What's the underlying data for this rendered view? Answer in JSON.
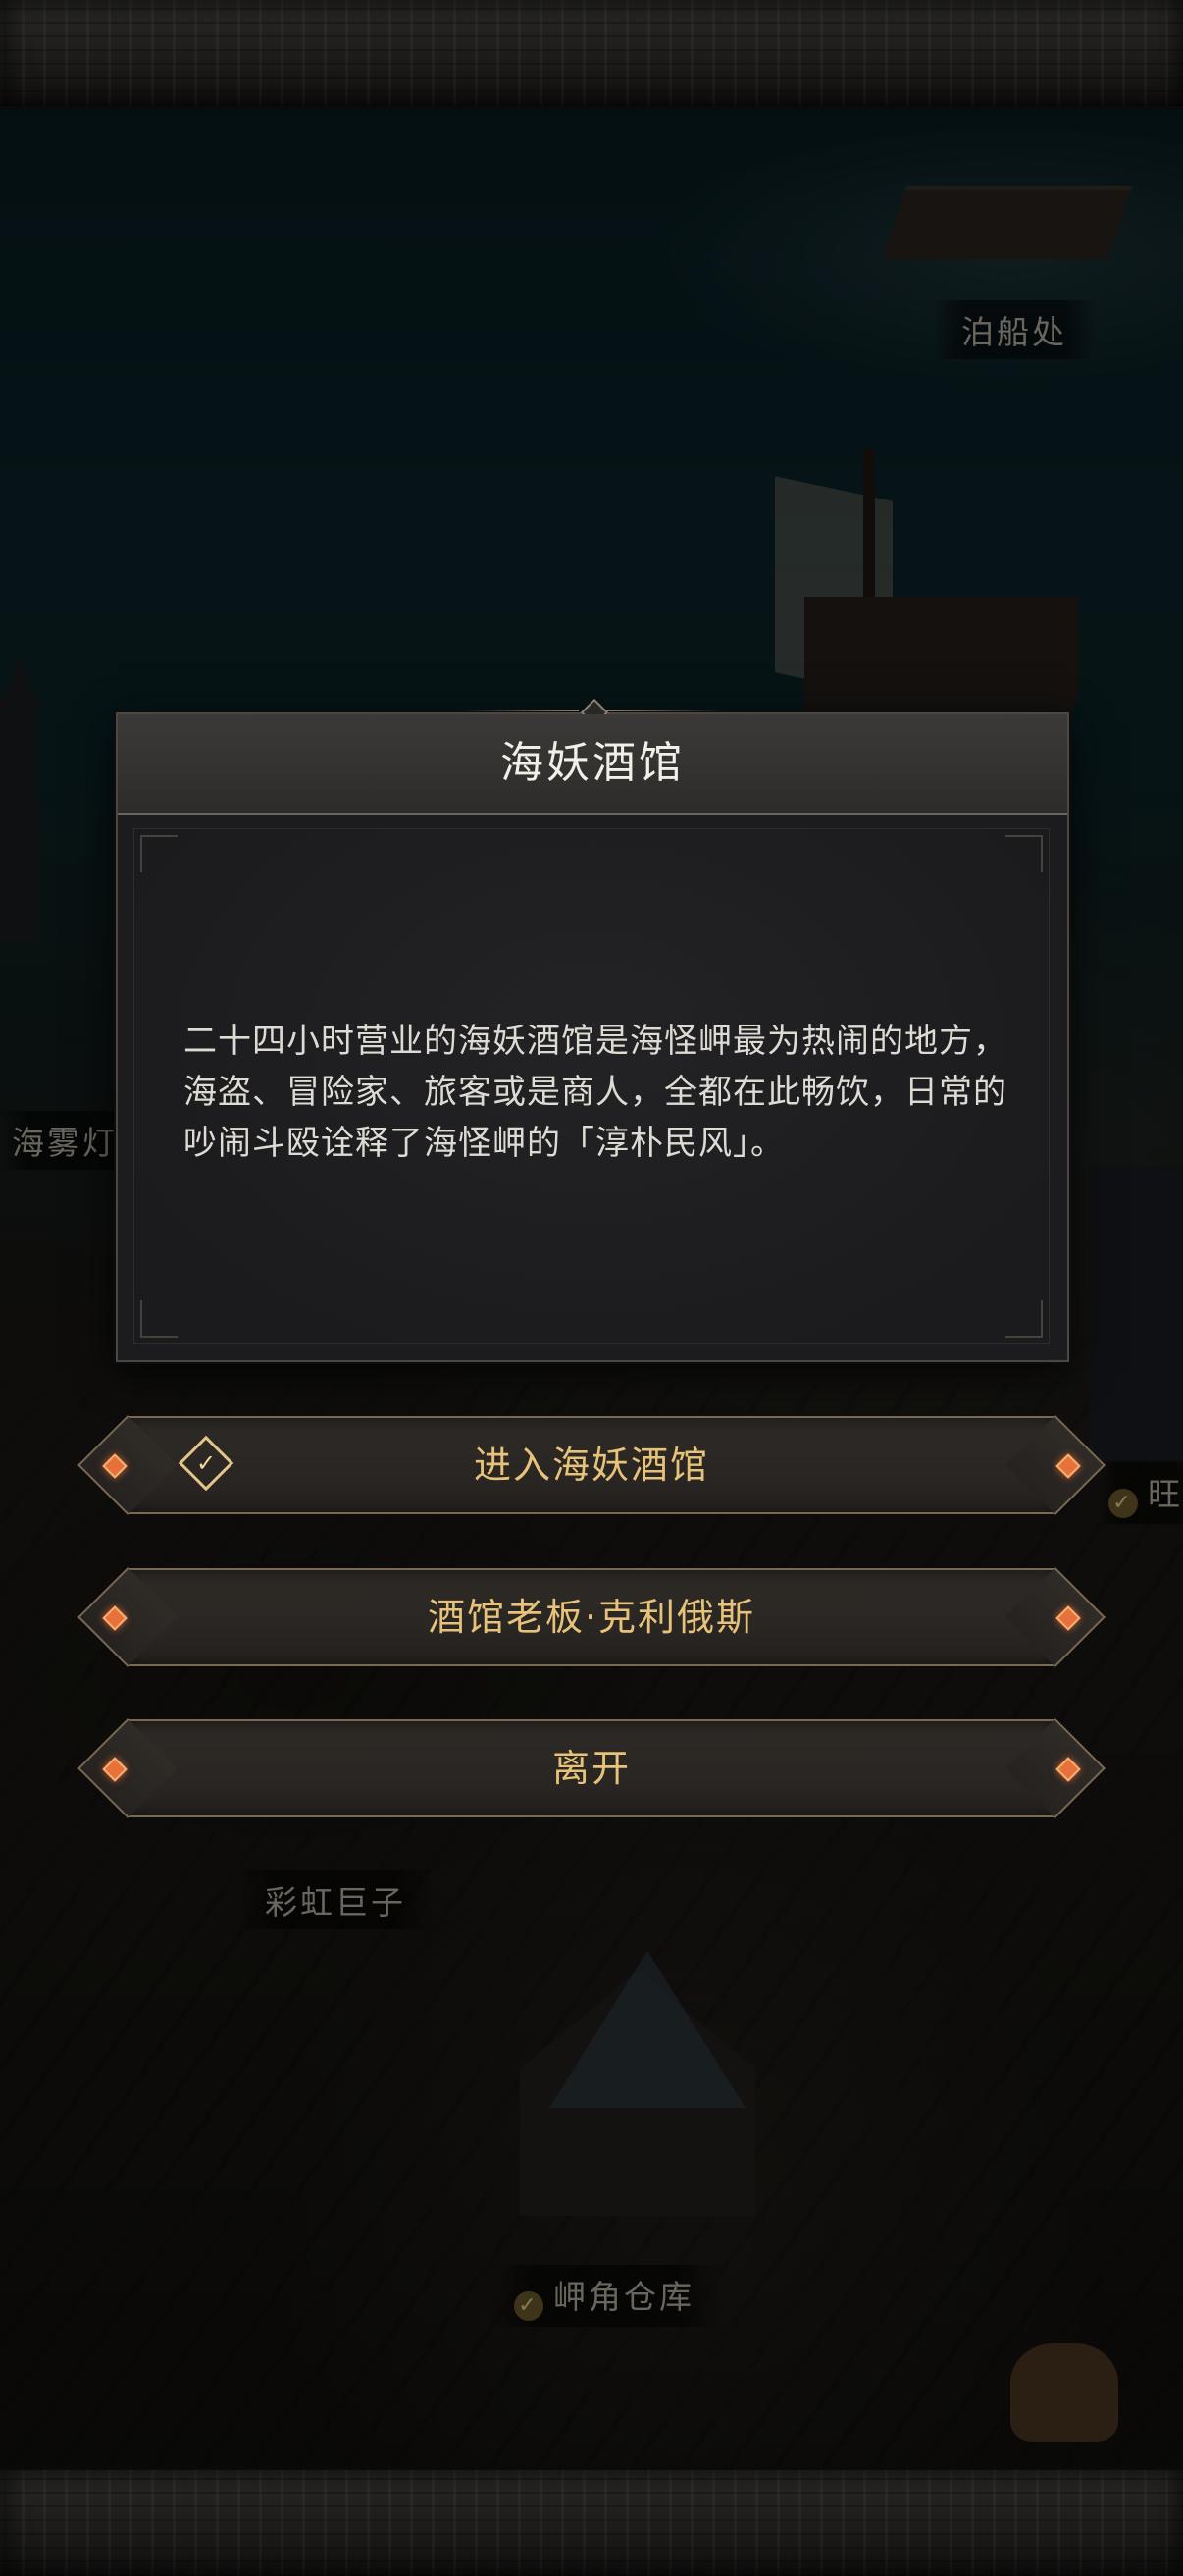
{
  "map": {
    "labels": {
      "dock": "泊船处",
      "lighthouse": "海雾灯",
      "rainbow_giant": "彩虹巨子",
      "warehouse": "岬角仓库",
      "right_partial": "旺"
    }
  },
  "dialog": {
    "title": "海妖酒馆",
    "description": "二十四小时营业的海妖酒馆是海怪岬最为热闹的地方，海盗、冒险家、旅客或是商人，全都在此畅饮，日常的吵闹斗殴诠释了海怪岬的「淳朴民风」。"
  },
  "options": [
    {
      "label": "进入海妖酒馆",
      "icon": "enter-icon"
    },
    {
      "label": "酒馆老板·克利俄斯"
    },
    {
      "label": "离开"
    }
  ],
  "colors": {
    "option_text": "#e6c27a",
    "gem": "#e8703a",
    "dialog_bg": "#1c1c1e"
  }
}
